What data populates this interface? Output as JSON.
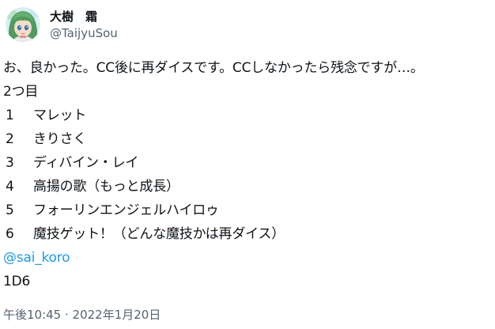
{
  "author": {
    "display_name": "大樹　霜",
    "handle": "@TaijyuSou",
    "avatar_icon": "anime-character-avatar-icon"
  },
  "tweet": {
    "lines": [
      "お、良かった。CC後に再ダイスです。CCしなかったら残念ですが…。",
      "2つ目"
    ],
    "list": [
      {
        "num": "1",
        "text": "マレット"
      },
      {
        "num": "2",
        "text": "きりさく"
      },
      {
        "num": "3",
        "text": "ディバイン・レイ"
      },
      {
        "num": "4",
        "text": "高揚の歌（もっと成長）"
      },
      {
        "num": "5",
        "text": "フォーリンエンジェルハイロゥ"
      },
      {
        "num": "6",
        "text": "魔技ゲット！（どんな魔技かは再ダイス）"
      }
    ],
    "mention": "@sai_koro",
    "dice": "1D6"
  },
  "meta": {
    "time": "午後10:45",
    "separator": " · ",
    "date": "2022年1月20日"
  },
  "colors": {
    "link": "#1d9bf0",
    "secondary_text": "#536471",
    "primary_text": "#0f1419"
  }
}
